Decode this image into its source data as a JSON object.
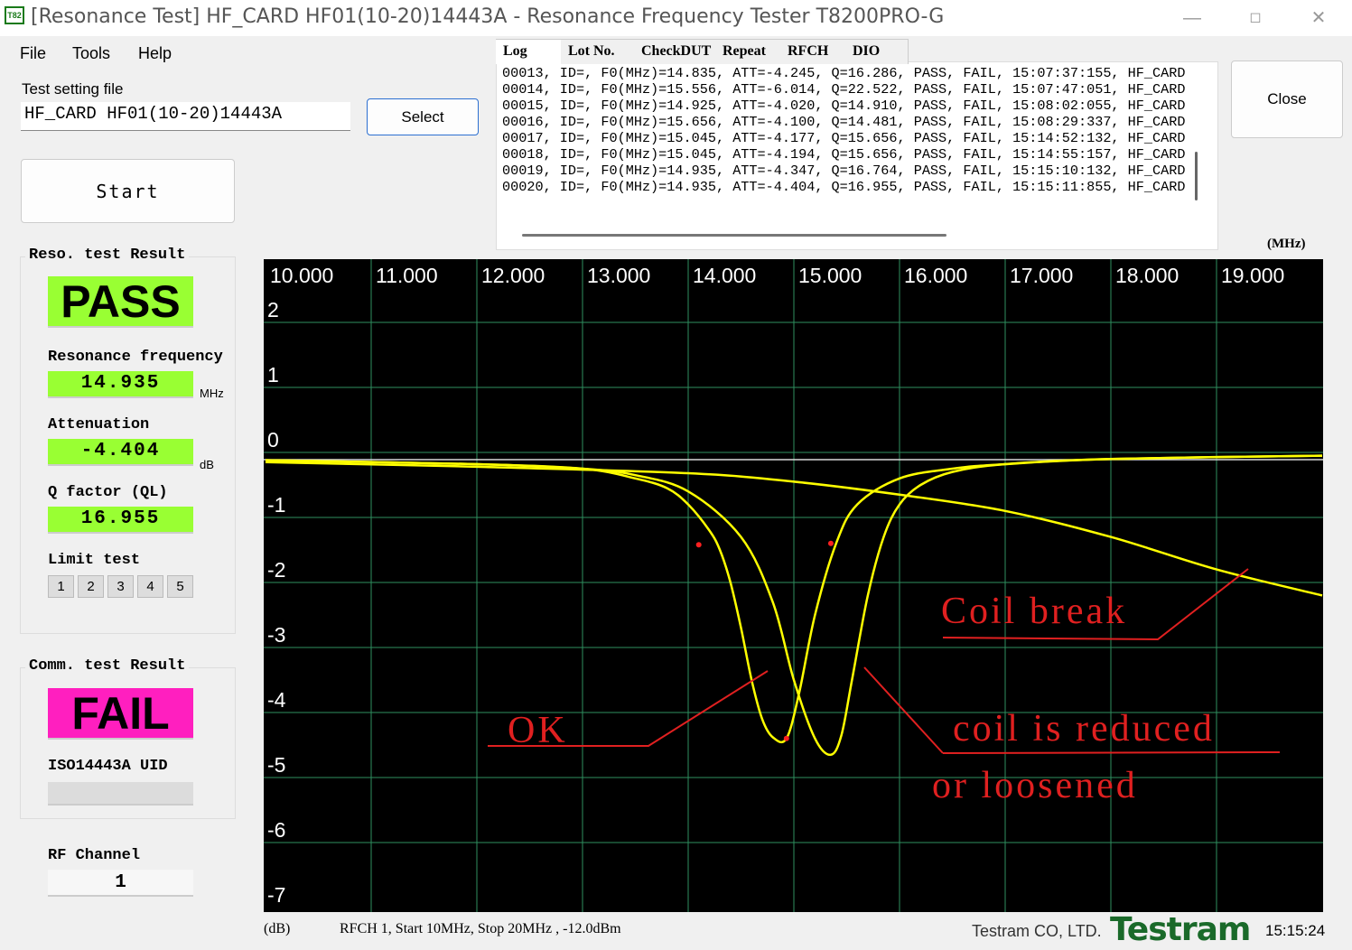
{
  "window": {
    "title": "[Resonance Test] HF_CARD HF01(10-20)14443A - Resonance Frequency Tester T8200PRO-G",
    "icon_text": "T82",
    "controls": [
      "minimize",
      "maximize",
      "close"
    ]
  },
  "menu": {
    "file": "File",
    "tools": "Tools",
    "help": "Help"
  },
  "settings": {
    "label": "Test setting file",
    "value": "HF_CARD HF01(10-20)14443A",
    "select_label": "Select",
    "start_label": "Start",
    "close_label": "Close"
  },
  "log": {
    "tabs": [
      "Log",
      "Lot No.",
      "CheckDUT",
      "Repeat",
      "RFCH",
      "DIO"
    ],
    "lines": [
      "00013, ID=, F0(MHz)=14.835, ATT=-4.245, Q=16.286, PASS, FAIL, 15:07:37:155, HF_CARD",
      "00014, ID=, F0(MHz)=15.556, ATT=-6.014, Q=22.522, PASS, FAIL, 15:07:47:051, HF_CARD",
      "00015, ID=, F0(MHz)=14.925, ATT=-4.020, Q=14.910, PASS, FAIL, 15:08:02:055, HF_CARD",
      "00016, ID=, F0(MHz)=15.656, ATT=-4.100, Q=14.481, PASS, FAIL, 15:08:29:337, HF_CARD",
      "00017, ID=, F0(MHz)=15.045, ATT=-4.177, Q=15.656, PASS, FAIL, 15:14:52:132, HF_CARD",
      "00018, ID=, F0(MHz)=15.045, ATT=-4.194, Q=15.656, PASS, FAIL, 15:14:55:157, HF_CARD",
      "00019, ID=, F0(MHz)=14.935, ATT=-4.347, Q=16.764, PASS, FAIL, 15:15:10:132, HF_CARD",
      "00020, ID=, F0(MHz)=14.935, ATT=-4.404, Q=16.955, PASS, FAIL, 15:15:11:855, HF_CARD"
    ]
  },
  "reso_result": {
    "title": "Reso. test Result",
    "status": "PASS",
    "status_color": "#99ff33",
    "freq_label": "Resonance frequency",
    "freq_value": "14.935",
    "freq_unit": "MHz",
    "att_label": "Attenuation",
    "att_value": "-4.404",
    "att_unit": "dB",
    "q_label": "Q factor (QL)",
    "q_value": "16.955",
    "limit_label": "Limit test",
    "limit_buttons": [
      "1",
      "2",
      "3",
      "4",
      "5"
    ]
  },
  "comm_result": {
    "title": "Comm. test Result",
    "status": "FAIL",
    "status_color": "#ff1fbf",
    "uid_label": "ISO14443A UID",
    "uid_value": "",
    "rf_label": "RF Channel",
    "rf_value": "1"
  },
  "chart_data": {
    "type": "line",
    "x_unit": "(MHz)",
    "y_unit": "(dB)",
    "x_ticks": [
      "10.000",
      "11.000",
      "12.000",
      "13.000",
      "14.000",
      "15.000",
      "16.000",
      "17.000",
      "18.000",
      "19.000"
    ],
    "y_ticks": [
      "2",
      "1",
      "0",
      "-1",
      "-2",
      "-3",
      "-4",
      "-5",
      "-6",
      "-7"
    ],
    "xlim": [
      10,
      20
    ],
    "ylim": [
      -7.2,
      2.4
    ],
    "grid": true,
    "line_color": "#ffff00",
    "marker_color": "#ff2020",
    "series": [
      {
        "x": [
          10.0,
          12.0,
          13.0,
          13.5,
          13.8,
          14.0,
          14.2,
          14.3,
          14.4,
          14.5,
          14.6,
          14.7,
          14.8,
          14.93,
          15.05,
          15.2,
          15.4,
          15.6,
          16.0,
          16.5,
          17.0,
          18.0,
          20.0
        ],
        "y": [
          -0.12,
          -0.18,
          -0.25,
          -0.4,
          -0.55,
          -0.8,
          -1.2,
          -1.5,
          -2.0,
          -2.7,
          -3.5,
          -4.1,
          -4.38,
          -4.4,
          -3.7,
          -2.5,
          -1.4,
          -0.8,
          -0.4,
          -0.25,
          -0.18,
          -0.1,
          -0.05
        ],
        "markers": [
          [
            14.1,
            -1.42
          ],
          [
            14.93,
            -4.4
          ],
          [
            15.35,
            -1.4
          ]
        ]
      },
      {
        "x": [
          10.0,
          12.0,
          13.0,
          13.5,
          14.0,
          14.5,
          14.8,
          15.0,
          15.2,
          15.35,
          15.45,
          15.55,
          15.7,
          15.85,
          16.0,
          16.2,
          16.5,
          17.0,
          18.0,
          20.0
        ],
        "y": [
          -0.12,
          -0.18,
          -0.25,
          -0.35,
          -0.6,
          -1.3,
          -2.3,
          -3.5,
          -4.4,
          -4.65,
          -4.35,
          -3.5,
          -2.2,
          -1.3,
          -0.8,
          -0.5,
          -0.3,
          -0.18,
          -0.1,
          -0.05
        ],
        "markers": []
      },
      {
        "x": [
          10.0,
          12.0,
          14.0,
          15.0,
          16.0,
          17.0,
          18.0,
          19.0,
          20.0
        ],
        "y": [
          -0.15,
          -0.22,
          -0.32,
          -0.45,
          -0.65,
          -0.9,
          -1.3,
          -1.8,
          -2.2
        ],
        "markers": []
      }
    ]
  },
  "annotations": {
    "ok": "OK",
    "coil_break": "Coil break",
    "coil_reduced_1": "coil is reduced",
    "coil_reduced_2": "or loosened"
  },
  "footer": {
    "info": "RFCH 1, Start 10MHz, Stop 20MHz , -12.0dBm",
    "company": "Testram CO, LTD.",
    "logo": "Testram",
    "time": "15:15:24"
  }
}
